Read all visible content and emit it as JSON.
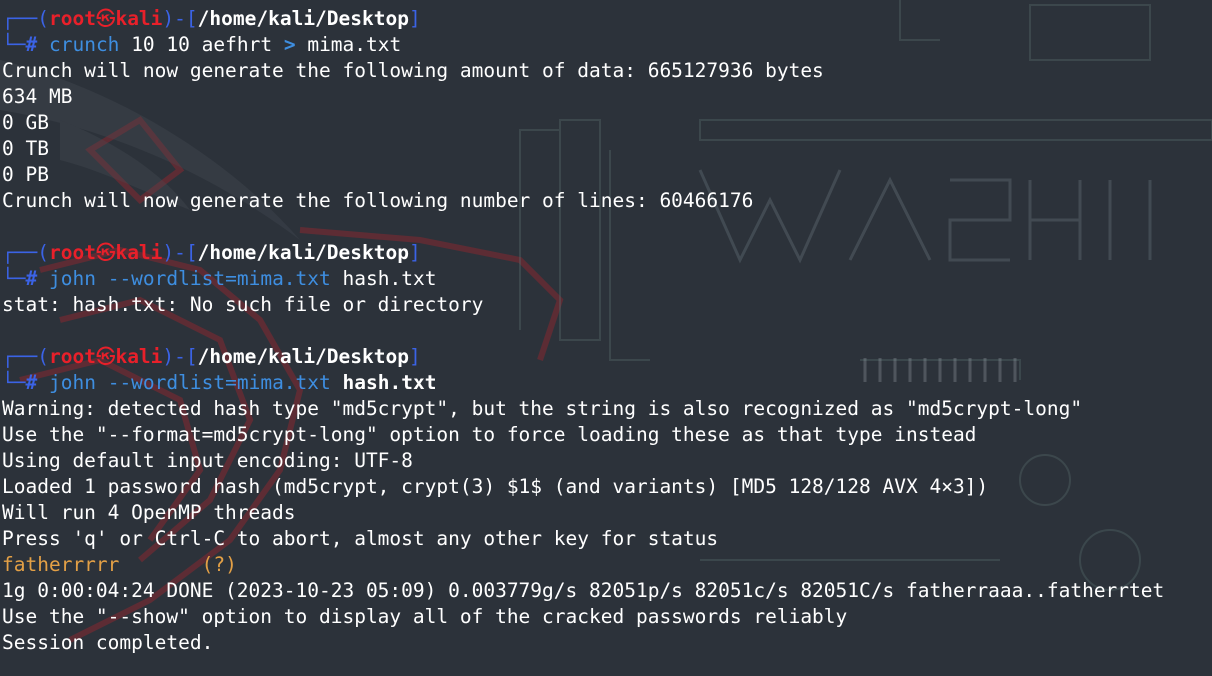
{
  "colors": {
    "background": "#2c323a",
    "prompt_box": "#3b63e6",
    "prompt_user": "#e8202a",
    "command": "#3e8ee0",
    "cracked_password": "#e3a046"
  },
  "prompt": {
    "top_left": "┌──(",
    "user": "root",
    "skull": "㉿",
    "host": "kali",
    "sep": ")-[",
    "path": "/home/kali/Desktop",
    "close": "]",
    "bottom_left": "└─",
    "hash": "#"
  },
  "blocks": [
    {
      "command": {
        "cmd": "crunch",
        "args": "10 10 aefhrt",
        "redirect": ">",
        "target": "mima.txt"
      },
      "output": [
        "Crunch will now generate the following amount of data: 665127936 bytes",
        "634 MB",
        "0 GB",
        "0 TB",
        "0 PB",
        "Crunch will now generate the following number of lines: 60466176"
      ]
    },
    {
      "command": {
        "cmd": "john",
        "args": "--wordlist=mima.txt",
        "file": "hash.txt"
      },
      "output": [
        "stat: hash.txt: No such file or directory"
      ]
    },
    {
      "command": {
        "cmd": "john",
        "args": "--wordlist=mima.txt",
        "file": "hash.txt"
      },
      "output_before": [
        "Warning: detected hash type \"md5crypt\", but the string is also recognized as \"md5crypt-long\"",
        "Use the \"--format=md5crypt-long\" option to force loading these as that type instead",
        "Using default input encoding: UTF-8",
        "Loaded 1 password hash (md5crypt, crypt(3) $1$ (and variants) [MD5 128/128 AVX 4×3])",
        "Will run 4 OpenMP threads",
        "Press 'q' or Ctrl-C to abort, almost any other key for status"
      ],
      "cracked": {
        "password": "fatherrrrr",
        "label": "(?)"
      },
      "output_after": [
        "1g 0:00:04:24 DONE (2023-10-23 05:09) 0.003779g/s 82051p/s 82051c/s 82051C/s fatherraaa..fatherrtet",
        "Use the \"--show\" option to display all of the cracked passwords reliably",
        "Session completed."
      ]
    }
  ]
}
